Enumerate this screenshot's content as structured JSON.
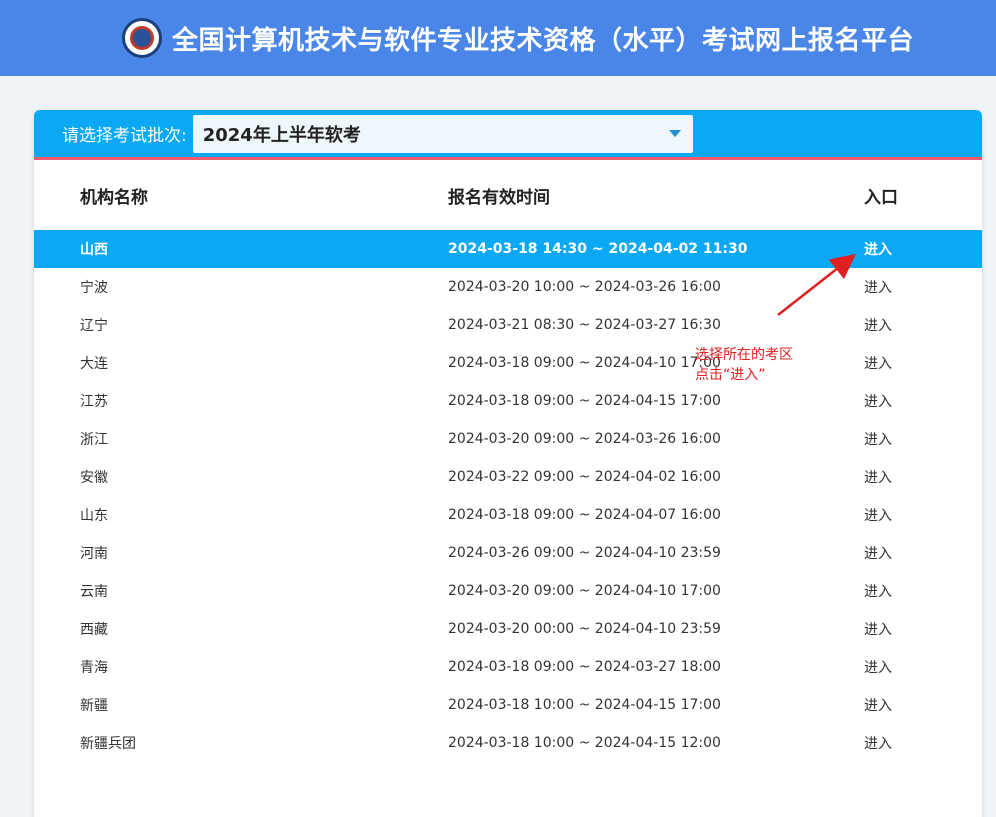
{
  "header": {
    "title": "全国计算机技术与软件专业技术资格（水平）考试网上报名平台"
  },
  "selector": {
    "label": "请选择考试批次:",
    "value": "2024年上半年软考"
  },
  "table": {
    "headers": [
      "机构名称",
      "报名有效时间",
      "入口"
    ],
    "rows": [
      {
        "name": "山西",
        "time": "2024-03-18 14:30 ~ 2024-04-02 11:30",
        "entry": "进入"
      },
      {
        "name": "宁波",
        "time": "2024-03-20 10:00 ~ 2024-03-26 16:00",
        "entry": "进入"
      },
      {
        "name": "辽宁",
        "time": "2024-03-21 08:30 ~ 2024-03-27 16:30",
        "entry": "进入"
      },
      {
        "name": "大连",
        "time": "2024-03-18 09:00 ~ 2024-04-10 17:00",
        "entry": "进入"
      },
      {
        "name": "江苏",
        "time": "2024-03-18 09:00 ~ 2024-04-15 17:00",
        "entry": "进入"
      },
      {
        "name": "浙江",
        "time": "2024-03-20 09:00 ~ 2024-03-26 16:00",
        "entry": "进入"
      },
      {
        "name": "安徽",
        "time": "2024-03-22 09:00 ~ 2024-04-02 16:00",
        "entry": "进入"
      },
      {
        "name": "山东",
        "time": "2024-03-18 09:00 ~ 2024-04-07 16:00",
        "entry": "进入"
      },
      {
        "name": "河南",
        "time": "2024-03-26 09:00 ~ 2024-04-10 23:59",
        "entry": "进入"
      },
      {
        "name": "云南",
        "time": "2024-03-20 09:00 ~ 2024-04-10 17:00",
        "entry": "进入"
      },
      {
        "name": "西藏",
        "time": "2024-03-20 00:00 ~ 2024-04-10 23:59",
        "entry": "进入"
      },
      {
        "name": "青海",
        "time": "2024-03-18 09:00 ~ 2024-03-27 18:00",
        "entry": "进入"
      },
      {
        "name": "新疆",
        "time": "2024-03-18 10:00 ~ 2024-04-15 17:00",
        "entry": "进入"
      },
      {
        "name": "新疆兵团",
        "time": "2024-03-18 10:00 ~ 2024-04-15 12:00",
        "entry": "进入"
      }
    ]
  },
  "annotation": {
    "line1": "选择所在的考区",
    "line2": "点击“进入”"
  },
  "colors": {
    "header": "#4a86e8",
    "accent": "#0aa8f5",
    "underline": "#ef5b6d",
    "annotation": "#e02020"
  }
}
